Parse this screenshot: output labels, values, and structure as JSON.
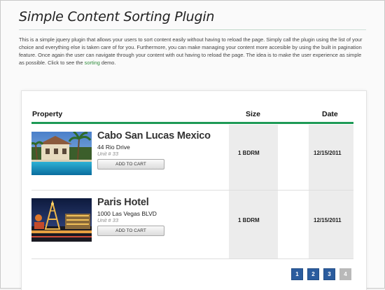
{
  "title": "Simple Content Sorting Plugin",
  "intro": {
    "text_before": "This is a simple jquery plugin that allows your users to sort content easily without having to reload the page. Simply call the plugin using the list of your choice and everything else is taken care of for you. Furthermore, you can make managing your content more accesible by using the built in pagination feature. Once again the user can navigate through your content with out having to reload the page. The idea is to make the user experience as simple as possible. Click to see the ",
    "link": "sorting",
    "text_after": " demo."
  },
  "table": {
    "headers": {
      "property": "Property",
      "size": "Size",
      "date": "Date"
    },
    "rows": [
      {
        "name": "Cabo San Lucas Mexico",
        "address": "44 Rio Drive",
        "unit": "Unit # 33",
        "cart": "ADD TO CART",
        "size": "1 BDRM",
        "date": "12/15/2011",
        "image": "villa-pool-image"
      },
      {
        "name": "Paris Hotel",
        "address": "1000 Las Vegas BLVD",
        "unit": "Unit # 33",
        "cart": "ADD TO CART",
        "size": "1 BDRM",
        "date": "12/15/2011",
        "image": "paris-hotel-night-image"
      }
    ]
  },
  "pagination": {
    "pages": [
      "1",
      "2",
      "3",
      "4"
    ],
    "disabled_page": "4"
  },
  "colors": {
    "accent": "#1e9a56",
    "link": "#2e8b3a",
    "page_button": "#2b5c9e"
  }
}
